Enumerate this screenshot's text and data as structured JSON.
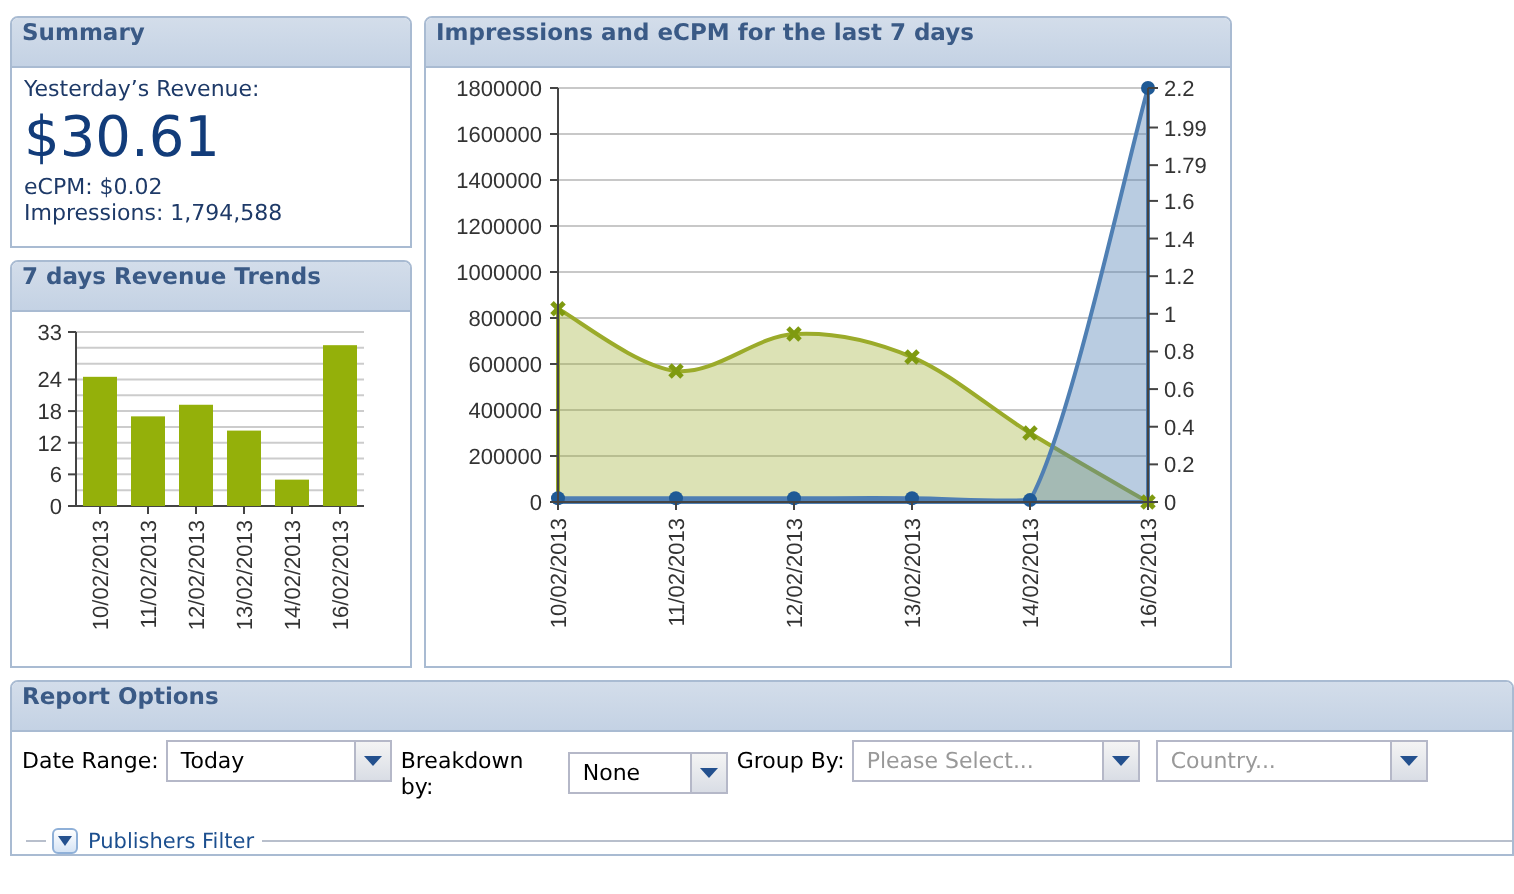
{
  "summary": {
    "title": "Summary",
    "revenue_label": "Yesterday’s Revenue:",
    "revenue": "$30.61",
    "ecpm": "eCPM: $0.02",
    "impressions": "Impressions: 1,794,588"
  },
  "revenue_trends": {
    "title": "7 days Revenue Trends",
    "chart_data": {
      "type": "bar",
      "categories": [
        "10/02/2013",
        "11/02/2013",
        "12/02/2013",
        "13/02/2013",
        "14/02/2013",
        "16/02/2013"
      ],
      "values": [
        24.5,
        17,
        19.2,
        14.3,
        5,
        30.5
      ],
      "color": "#94b00a",
      "grid": true,
      "ylim": [
        0,
        33
      ],
      "yticks": [
        0,
        6,
        12,
        18,
        24,
        33
      ]
    }
  },
  "impressions_chart": {
    "title": "Impressions and eCPM for the last 7 days",
    "chart_data": {
      "type": "area",
      "categories": [
        "10/02/2013",
        "11/02/2013",
        "12/02/2013",
        "13/02/2013",
        "14/02/2013",
        "16/02/2013"
      ],
      "series": [
        {
          "color": "#9bab2a",
          "values": [
            840000,
            570000,
            730000,
            630000,
            300000,
            0
          ]
        },
        {
          "color": "#4f7fb3",
          "axis": "y2",
          "values": [
            0.02,
            0.02,
            0.02,
            0.02,
            0.01,
            2.2
          ]
        }
      ],
      "grid": true,
      "ylim": [
        0,
        1800000
      ],
      "yticks": [
        0,
        200000,
        400000,
        600000,
        800000,
        1000000,
        1200000,
        1400000,
        1600000,
        1800000
      ],
      "y2lim": [
        0,
        2.2
      ],
      "y2ticks": [
        0,
        0.2,
        0.4,
        0.6,
        0.8,
        1,
        1.2,
        1.4,
        1.6,
        1.79,
        1.99,
        2.2
      ]
    }
  },
  "report_options": {
    "title": "Report Options",
    "fields": [
      {
        "label": "Date Range:",
        "value": "Today"
      },
      {
        "label": "Breakdown by:",
        "value": "None"
      },
      {
        "label": "Group By:",
        "placeholder": "Please Select..."
      },
      {
        "placeholder": "Country..."
      }
    ],
    "filter": {
      "label": "Publishers Filter",
      "expanded": false
    }
  }
}
